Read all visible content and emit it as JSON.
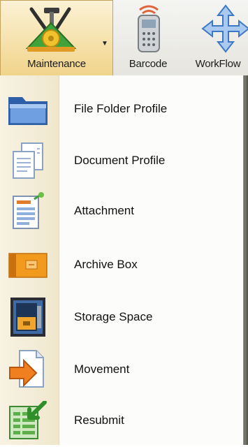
{
  "toolbar": {
    "maintenance_label": "Maintenance",
    "barcode_label": "Barcode",
    "workflow_label": "WorkFlow",
    "maintenance_icon": "maintenance-tools-icon",
    "barcode_icon": "barcode-scanner-icon",
    "workflow_icon": "workflow-arrows-icon"
  },
  "menu": {
    "items": [
      {
        "label": "File Folder Profile",
        "icon": "folder-icon"
      },
      {
        "label": "Document Profile",
        "icon": "documents-icon"
      },
      {
        "label": "Attachment",
        "icon": "attachment-icon"
      },
      {
        "label": "Archive Box",
        "icon": "archive-box-icon"
      },
      {
        "label": "Storage Space",
        "icon": "storage-safe-icon"
      },
      {
        "label": "Movement",
        "icon": "movement-arrow-icon"
      },
      {
        "label": "Resubmit",
        "icon": "resubmit-icon"
      }
    ]
  },
  "colors": {
    "active_tab_top": "#fbf2d5",
    "active_tab_bottom": "#f1d48b",
    "menu_gutter": "#f3ebd4",
    "folder_blue": "#3d6fb6",
    "archive_orange": "#f19a1e",
    "movement_orange": "#f0801f",
    "resubmit_green": "#49a83a"
  }
}
